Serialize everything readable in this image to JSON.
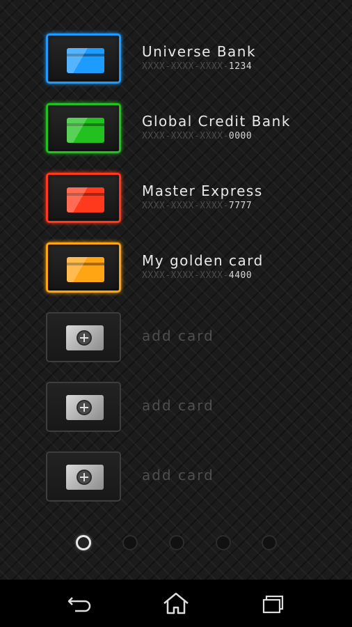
{
  "cards": [
    {
      "name": "Universe Bank",
      "mask": "XXXX-XXXX-XXXX-",
      "last4": "1234",
      "accent": "#1e9bff"
    },
    {
      "name": "Global Credit Bank",
      "mask": "XXXX-XXXX-XXXX-",
      "last4": "0000",
      "accent": "#22c11f"
    },
    {
      "name": "Master Express",
      "mask": "XXXX-XXXX-XXXX-",
      "last4": "7777",
      "accent": "#ff3a1c"
    },
    {
      "name": "My golden card",
      "mask": "XXXX-XXXX-XXXX-",
      "last4": "4400",
      "accent": "#ffa412"
    }
  ],
  "add_slots": [
    {
      "label": "add card"
    },
    {
      "label": "add card"
    },
    {
      "label": "add card"
    }
  ],
  "pager": {
    "total": 5,
    "active": 0
  },
  "navbar": {
    "back_icon": "back-icon",
    "home_icon": "home-icon",
    "recents_icon": "recents-icon"
  }
}
